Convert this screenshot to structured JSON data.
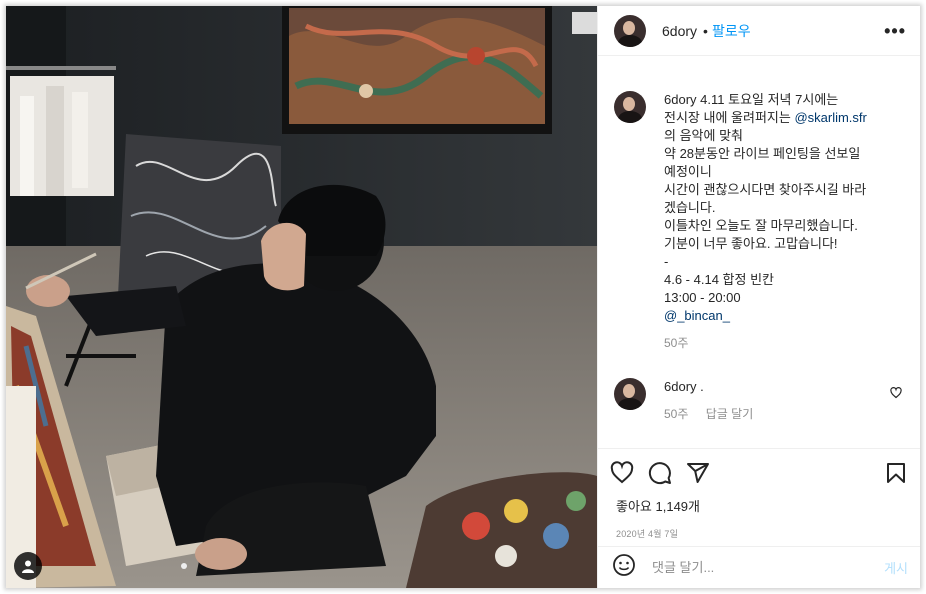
{
  "header": {
    "username": "6dory",
    "separator": "•",
    "follow_label": "팔로우",
    "more_label": "•••"
  },
  "caption": {
    "username": "6dory",
    "lines": [
      "4.11 토요일 저녁 7시에는",
      "전시장 내에 울려퍼지는 ",
      "의 음악에 맞춰",
      "약 28분동안 라이브 페인팅을 선보일",
      "예정이니",
      "시간이 괜찮으시다면 찾아주시길 바라",
      "겠습니다.",
      "이틀차인 오늘도 잘 마무리했습니다.",
      "기분이 너무 좋아요. 고맙습니다!",
      "-",
      "4.6 - 4.14 합정 빈칸",
      "13:00 - 20:00"
    ],
    "mention1": "@skarlim.sfr",
    "mention2": "@_bincan_",
    "age": "50주"
  },
  "comment": {
    "username": "6dory",
    "text": ".",
    "age": "50주",
    "reply_label": "답글 달기"
  },
  "actions": {
    "icons": [
      "heart-icon",
      "comment-icon",
      "share-icon",
      "bookmark-icon"
    ],
    "likes": "좋아요 1,149개",
    "date": "2020년 4월 7일"
  },
  "compose": {
    "placeholder": "댓글 달기...",
    "post_label": "게시"
  },
  "colors": {
    "accent": "#0095f6",
    "link": "#00376b",
    "muted": "#8e8e8e"
  }
}
